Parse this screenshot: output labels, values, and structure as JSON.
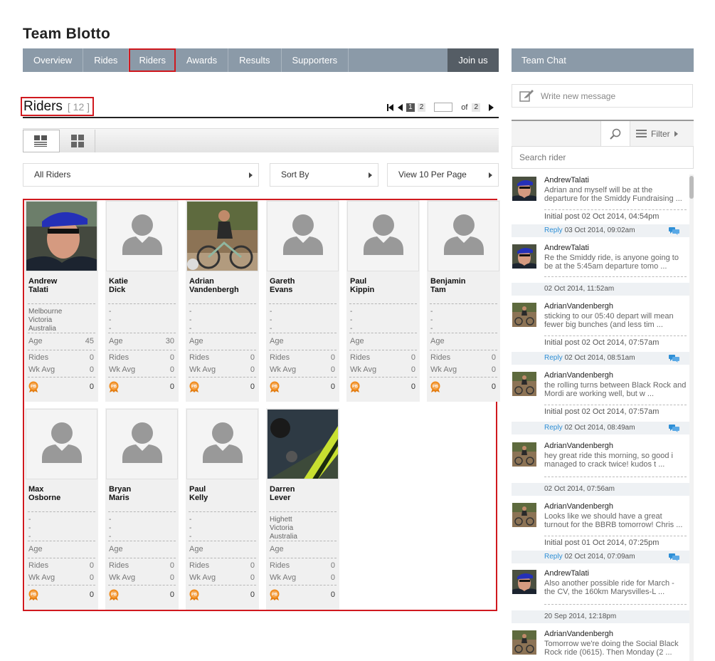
{
  "page": {
    "team_title": "Team Blotto"
  },
  "nav": {
    "items": [
      "Overview",
      "Rides",
      "Riders",
      "Awards",
      "Results",
      "Supporters"
    ],
    "active_index": 2,
    "join_label": "Join us"
  },
  "riders": {
    "title": "Riders",
    "count": "[ 12 ]",
    "pager": {
      "pages": [
        "1",
        "2"
      ],
      "current": "1",
      "of_label": "of",
      "total": "2"
    }
  },
  "filters": {
    "riders_label": "All Riders",
    "sort_label": "Sort By",
    "per_page_label": "View 10 Per Page"
  },
  "labels": {
    "age": "Age",
    "rides": "Rides",
    "wk_avg": "Wk Avg"
  },
  "rider_cards": [
    {
      "first": "Andrew",
      "last": "Talati",
      "photo": "andrew-photo",
      "loc": [
        "Melbourne",
        "Victoria",
        "Australia"
      ],
      "age": "45",
      "rides": "0",
      "wk_avg": "0",
      "pb": "0"
    },
    {
      "first": "Katie",
      "last": "Dick",
      "photo": "placeholder",
      "loc": [
        "-",
        "-",
        "-"
      ],
      "age": "30",
      "rides": "0",
      "wk_avg": "0",
      "pb": "0"
    },
    {
      "first": "Adrian",
      "last": "Vandenbergh",
      "photo": "adrian-photo",
      "loc": [
        "-",
        "-",
        "-"
      ],
      "age": "",
      "rides": "0",
      "wk_avg": "0",
      "pb": "0"
    },
    {
      "first": "Gareth",
      "last": "Evans",
      "photo": "placeholder",
      "loc": [
        "-",
        "-",
        "-"
      ],
      "age": "",
      "rides": "0",
      "wk_avg": "0",
      "pb": "0"
    },
    {
      "first": "Paul",
      "last": "Kippin",
      "photo": "placeholder",
      "loc": [
        "-",
        "-",
        "-"
      ],
      "age": "",
      "rides": "0",
      "wk_avg": "0",
      "pb": "0"
    },
    {
      "first": "Benjamin",
      "last": "Tam",
      "photo": "placeholder",
      "loc": [
        "-",
        "-",
        "-"
      ],
      "age": "",
      "rides": "0",
      "wk_avg": "0",
      "pb": "0"
    },
    {
      "first": "Max",
      "last": "Osborne",
      "photo": "placeholder",
      "loc": [
        "-",
        "-",
        "-"
      ],
      "age": "",
      "rides": "0",
      "wk_avg": "0",
      "pb": "0"
    },
    {
      "first": "Bryan",
      "last": "Maris",
      "photo": "placeholder",
      "loc": [
        "-",
        "-",
        "-"
      ],
      "age": "",
      "rides": "0",
      "wk_avg": "0",
      "pb": "0"
    },
    {
      "first": "Paul",
      "last": "Kelly",
      "photo": "placeholder",
      "loc": [
        "-",
        "-",
        "-"
      ],
      "age": "",
      "rides": "0",
      "wk_avg": "0",
      "pb": "0"
    },
    {
      "first": "Darren",
      "last": "Lever",
      "photo": "darren-photo",
      "loc": [
        "Highett",
        "Victoria",
        "Australia"
      ],
      "age": "",
      "rides": "0",
      "wk_avg": "0",
      "pb": "0"
    }
  ],
  "chat": {
    "title": "Team Chat",
    "write_placeholder": "Write new message",
    "filter_label": "Filter",
    "search_placeholder": "Search rider",
    "reply_label": "Reply",
    "messages": [
      {
        "author": "AndrewTalati",
        "avatar": "andrew",
        "body": "Adrian and myself will be at the departure for the Smiddy Fundraising ...",
        "initial": "Initial post 02 Oct 2014, 04:54pm",
        "footer": "03 Oct 2014, 09:02am",
        "has_reply": true
      },
      {
        "author": "AndrewTalati",
        "avatar": "andrew",
        "body": "Re the Smiddy ride, is anyone going to be at the 5:45am departure tomo ...",
        "initial": "",
        "footer": "02 Oct 2014, 11:52am",
        "has_reply": false
      },
      {
        "author": "AdrianVandenbergh",
        "avatar": "adrian",
        "body": "sticking to our 05:40 depart will mean fewer big bunches (and less tim ...",
        "initial": "Initial post 02 Oct 2014, 07:57am",
        "footer": "02 Oct 2014, 08:51am",
        "has_reply": true
      },
      {
        "author": "AdrianVandenbergh",
        "avatar": "adrian",
        "body": "the rolling turns between Black Rock and Mordi are working well, but w ...",
        "initial": "Initial post 02 Oct 2014, 07:57am",
        "footer": "02 Oct 2014, 08:49am",
        "has_reply": true
      },
      {
        "author": "AdrianVandenbergh",
        "avatar": "adrian",
        "body": "hey great ride this morning, so good i managed to crack twice! kudos t ...",
        "initial": "",
        "footer": "02 Oct 2014, 07:56am",
        "has_reply": false
      },
      {
        "author": "AdrianVandenbergh",
        "avatar": "adrian",
        "body": "Looks like we should have a great turnout for the BBRB tomorrow! Chris ...",
        "initial": "Initial post 01 Oct 2014, 07:25pm",
        "footer": "02 Oct 2014, 07:09am",
        "has_reply": true
      },
      {
        "author": "AndrewTalati",
        "avatar": "andrew",
        "body": "Also another possible ride for March - the CV, the 160km Marysvilles-L ...",
        "initial": "",
        "footer": "20 Sep 2014, 12:18pm",
        "has_reply": false
      },
      {
        "author": "AdrianVandenbergh",
        "avatar": "adrian",
        "body": "Tomorrow we're doing the Social Black Rock ride (0615). Then Monday (2 ...",
        "initial": "",
        "footer": "",
        "has_reply": false
      }
    ]
  }
}
